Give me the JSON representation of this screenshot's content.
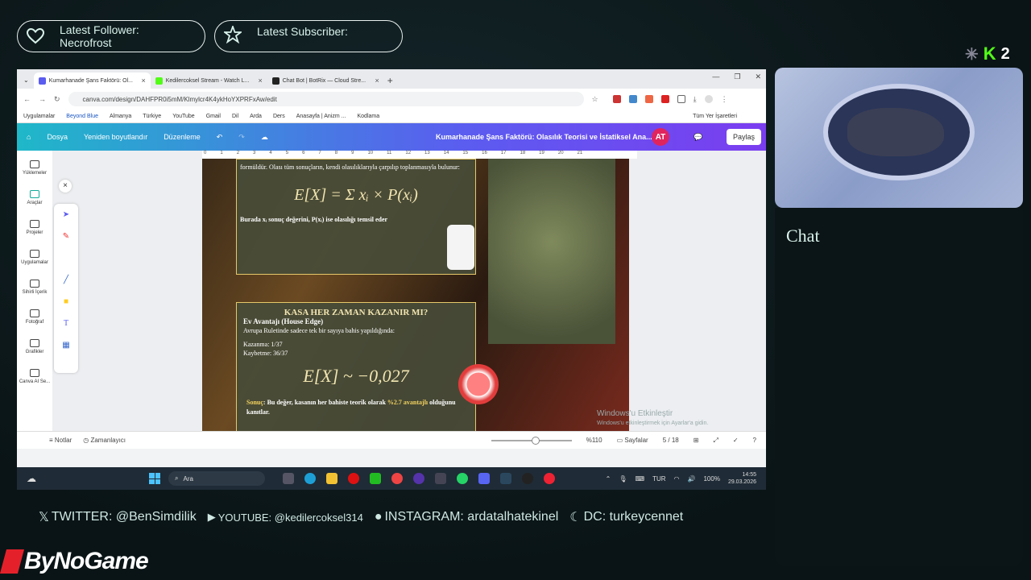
{
  "overlay": {
    "follower_label": "Latest Follower:",
    "follower_name": "Necrofrost",
    "subscriber_label": "Latest Subscriber:",
    "kick_count": "2",
    "chat_title": "Chat",
    "socials": [
      {
        "icon": "twitter-icon",
        "text": "TWITTER: @BenSimdilik"
      },
      {
        "icon": "youtube-icon",
        "text": "YOUTUBE: @kedilercoksel314"
      },
      {
        "icon": "instagram-icon",
        "text": "INSTAGRAM: ardatalhatekinel"
      },
      {
        "icon": "discord-icon",
        "text": "DC: turkeycennet"
      }
    ],
    "brand": "ByNoGame"
  },
  "browser": {
    "tabs": [
      {
        "label": "Kumarhanade Şans Faktörü: Ol...",
        "color": "#5b5cf0"
      },
      {
        "label": "Kedilercoksel Stream - Watch L...",
        "color": "#53fc18"
      },
      {
        "label": "Chat Bot | BotRix — Cloud Stre...",
        "color": "#222222"
      }
    ],
    "url": "canva.com/design/DAHFPR0i5mM/Klmylcr4K4ykHoYXPRFxAw/edit",
    "bookmarks": [
      "Uygulamalar",
      "Beyond Blue",
      "Almanya",
      "Türkiye",
      "YouTube",
      "Gmail",
      "Dil",
      "Arda",
      "Ders",
      "Anasayfa | Anizm ...",
      "Kodlama"
    ],
    "bookmarks_right": "Tüm Yer İşaretleri"
  },
  "canva": {
    "menu": [
      "Dosya",
      "Yeniden boyutlandır",
      "Düzenleme"
    ],
    "title": "Kumarhanade Şans Faktörü: Olasılık Teorisi ve İstatiksel Ana...",
    "avatar": "AT",
    "share": "Paylaş",
    "rail": [
      "Yüklemeler",
      "Araçlar",
      "Projeler",
      "Uygulamalar",
      "Sihirli İçerik",
      "Fotoğraf",
      "Grafikler",
      "Canva AI Se..."
    ],
    "ruler": [
      "0",
      "1",
      "2",
      "3",
      "4",
      "5",
      "6",
      "7",
      "8",
      "9",
      "10",
      "11",
      "12",
      "13",
      "14",
      "15",
      "16",
      "17",
      "18",
      "19",
      "20",
      "21"
    ],
    "card1_text": "formüldür. Olası tüm sonuçların, kendi olasılıklarıyla çarpılıp toplanmasıyla bulunur:",
    "card1_formula": "E[X] = Σ xᵢ × P(xᵢ)",
    "card1_text2": "Burada xᵢ sonuç değerini, P(xᵢ) ise olasılığı temsil eder",
    "card2_title": "KASA HER ZAMAN KAZANIR MI?",
    "card2_sub": "Ev Avantajı (House Edge)",
    "card2_line": "Avrupa Ruletinde sadece tek bir sayıya bahis yapıldığında:",
    "card2_win": "Kazanma: 1/37",
    "card2_lose": "Kaybetme: 36/37",
    "card2_formula": "E[X] ~ −0,027",
    "card2_result_label": "Sonuç",
    "card2_result": ": Bu değer, kasanın her bahiste teorik olarak ",
    "card2_result_hl": "%2.7 avantajlı",
    "card2_result_end": " olduğunu kanıtlar.",
    "win_activate": "Windows'u Etkinleştir",
    "win_activate_sub": "Windows'u etkinleştirmek için Ayarlar'a gidin.",
    "status_notes": "Notlar",
    "status_timer": "Zamanlayıcı",
    "zoom": "%110",
    "pages_label": "Sayfalar",
    "page": "5 / 18",
    "zoom_level": 0.55
  },
  "taskbar": {
    "search": "Ara",
    "lang": "TUR",
    "battery": "100%",
    "time": "14:55",
    "date": "29.03.2026"
  }
}
